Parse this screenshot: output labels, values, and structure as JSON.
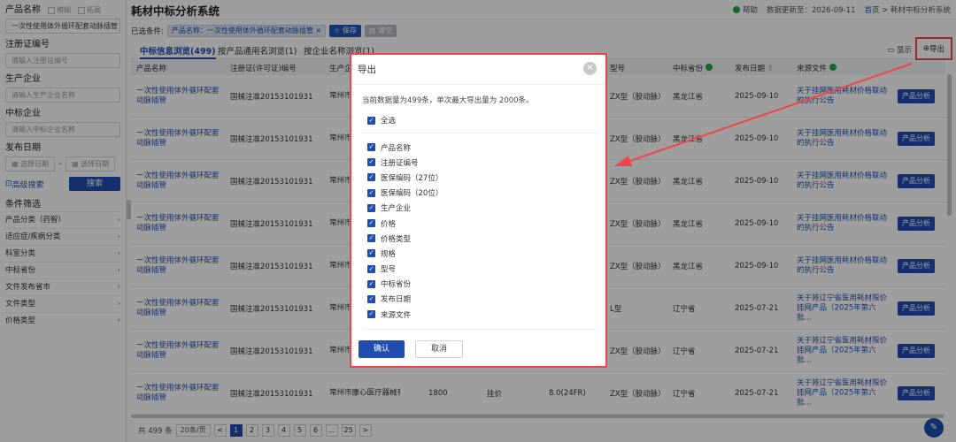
{
  "sidebar": {
    "product_name_label": "产品名称",
    "fuzzy_label": "模糊",
    "expand_label": "拓展",
    "product_name_value": "一次性使用体外循环配套动脉插管",
    "reg_label": "注册证编号",
    "reg_placeholder": "请输入注册证编号",
    "producer_label": "生产企业",
    "producer_placeholder": "请输入生产企业名称",
    "bidder_label": "中标企业",
    "bidder_placeholder": "请输入中标企业名称",
    "date_label": "发布日期",
    "date_start_placeholder": "选择日期",
    "date_end_placeholder": "选择日期",
    "advanced_search": "高级搜索",
    "search_button": "搜索",
    "condition_title": "条件筛选",
    "conditions": [
      {
        "label": "产品分类（药智）"
      },
      {
        "label": "适应症/疾病分类"
      },
      {
        "label": "科室分类"
      },
      {
        "label": "中标省份"
      },
      {
        "label": "文件发布省市"
      },
      {
        "label": "文件类型"
      },
      {
        "label": "价格类型"
      }
    ]
  },
  "header": {
    "title": "耗材中标分析系统",
    "help": "帮助",
    "update_label": "数据更新至：2026-09-11",
    "crumb_home": "首页",
    "crumb_sep": ">",
    "crumb_current": "耗材中标分析系统"
  },
  "filter": {
    "label": "已选条件:",
    "tag": "产品名称：一次性使用体外循环配套动脉插管 ×",
    "save": "☆ 保存",
    "clear": "清空"
  },
  "tabs": [
    {
      "label": "中标信息浏览(499)"
    },
    {
      "label": "按产品通用名浏览(1)"
    },
    {
      "label": "按企业名称浏览(1)"
    }
  ],
  "toolbar": {
    "display": "显示",
    "export": "导出"
  },
  "table": {
    "headers": {
      "name": "产品名称",
      "reg": "注册证(许可证)编号",
      "comp": "生产企",
      "model": "型号",
      "prov": "中标省份",
      "date": "发布日期",
      "doc": "来源文件"
    },
    "rows": [
      {
        "name": "一次性使用体外循环配套动脉插管",
        "reg": "国械注准20153101931",
        "comp": "常州市司",
        "qty": "",
        "ptype": "",
        "spec": "",
        "model": "ZX型（股动脉）",
        "prov": "黑龙江省",
        "date": "2025-09-10",
        "doc": "关于挂网医用耗材价格联动的执行公告",
        "btn": "产品分析"
      },
      {
        "name": "一次性使用体外循环配套动脉插管",
        "reg": "国械注准20153101931",
        "comp": "常州市司",
        "qty": "",
        "ptype": "",
        "spec": "",
        "model": "ZX型（股动脉）",
        "prov": "黑龙江省",
        "date": "2025-09-10",
        "doc": "关于挂网医用耗材价格联动的执行公告",
        "btn": "产品分析"
      },
      {
        "name": "一次性使用体外循环配套动脉插管",
        "reg": "国械注准20153101931",
        "comp": "常州市司",
        "qty": "",
        "ptype": "",
        "spec": "",
        "model": "ZX型（股动脉）",
        "prov": "黑龙江省",
        "date": "2025-09-10",
        "doc": "关于挂网医用耗材价格联动的执行公告",
        "btn": "产品分析"
      },
      {
        "name": "一次性使用体外循环配套动脉插管",
        "reg": "国械注准20153101931",
        "comp": "常州市司",
        "qty": "",
        "ptype": "",
        "spec": "",
        "model": "ZX型（股动脉）",
        "prov": "黑龙江省",
        "date": "2025-09-10",
        "doc": "关于挂网医用耗材价格联动的执行公告",
        "btn": "产品分析"
      },
      {
        "name": "一次性使用体外循环配套动脉插管",
        "reg": "国械注准20153101931",
        "comp": "常州市司",
        "qty": "",
        "ptype": "",
        "spec": "",
        "model": "ZX型（股动脉）",
        "prov": "黑龙江省",
        "date": "2025-09-10",
        "doc": "关于挂网医用耗材价格联动的执行公告",
        "btn": "产品分析"
      },
      {
        "name": "一次性使用体外循环配套动脉插管",
        "reg": "国械注准20153101931",
        "comp": "常州市司",
        "qty": "",
        "ptype": "",
        "spec": "",
        "model": "L型",
        "prov": "辽宁省",
        "date": "2025-07-21",
        "doc": "关于将辽宁省医用耗材限价挂网产品（2025年第六批...",
        "btn": "产品分析"
      },
      {
        "name": "一次性使用体外循环配套动脉插管",
        "reg": "国械注准20153101931",
        "comp": "常州市司",
        "qty": "",
        "ptype": "",
        "spec": "",
        "model": "ZX型（股动脉）",
        "prov": "辽宁省",
        "date": "2025-07-21",
        "doc": "关于将辽宁省医用耗材限价挂网产品（2025年第六批...",
        "btn": "产品分析"
      },
      {
        "name": "一次性使用体外循环配套动脉插管",
        "reg": "国械注准20153101931",
        "comp": "常州市康心医疗器械有限公司",
        "qty": "1800",
        "ptype": "挂价",
        "spec": "8.0(24FR)",
        "model": "ZX型（股动脉）",
        "prov": "辽宁省",
        "date": "2025-07-21",
        "doc": "关于将辽宁省医用耗材限价挂网产品（2025年第六批...",
        "btn": "产品分析"
      }
    ]
  },
  "pagination": {
    "total": "共 499 条",
    "page_size": "20条/页",
    "prev": "<",
    "pages": [
      "1",
      "2",
      "3",
      "4",
      "5",
      "6",
      "...",
      "25"
    ],
    "next": ">"
  },
  "modal": {
    "title": "导出",
    "close": "×",
    "info": "当前数据量为499条，单次最大导出量为 2000条。",
    "select_all": "全选",
    "fields": [
      {
        "label": "产品名称"
      },
      {
        "label": "注册证编号"
      },
      {
        "label": "医保编码（27位）"
      },
      {
        "label": "医保编码（20位）"
      },
      {
        "label": "生产企业"
      },
      {
        "label": "价格"
      },
      {
        "label": "价格类型"
      },
      {
        "label": "规格"
      },
      {
        "label": "型号"
      },
      {
        "label": "中标省份"
      },
      {
        "label": "发布日期"
      },
      {
        "label": "来源文件"
      }
    ],
    "confirm": "确认",
    "cancel": "取消"
  },
  "colors": {
    "primary": "#1f4db0",
    "highlight": "#f0444c",
    "green": "#2aa34a"
  }
}
